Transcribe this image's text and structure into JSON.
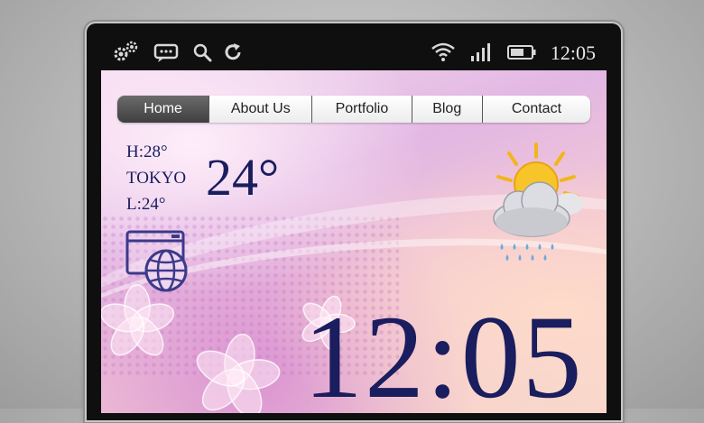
{
  "status_bar": {
    "icons": [
      "settings-gears-icon",
      "message-icon",
      "search-icon",
      "refresh-icon",
      "wifi-icon",
      "signal-icon",
      "battery-icon"
    ],
    "time": "12:05"
  },
  "nav": {
    "tabs": [
      {
        "label": "Home",
        "active": true
      },
      {
        "label": "About Us",
        "active": false
      },
      {
        "label": "Portfolio",
        "active": false
      },
      {
        "label": "Blog",
        "active": false
      },
      {
        "label": "Contact",
        "active": false
      }
    ]
  },
  "weather": {
    "high": "H:28°",
    "city": "TOKYO",
    "low": "L:24°",
    "current_temp": "24°",
    "condition_icon": "sun-cloud-rain-icon"
  },
  "widget": {
    "icon": "browser-globe-icon"
  },
  "clock": {
    "time": "12:05"
  },
  "colors": {
    "text": "#1a1d5e",
    "status_bar_bg": "#0f0f10",
    "nav_active_bg": "#4a4a4a"
  }
}
